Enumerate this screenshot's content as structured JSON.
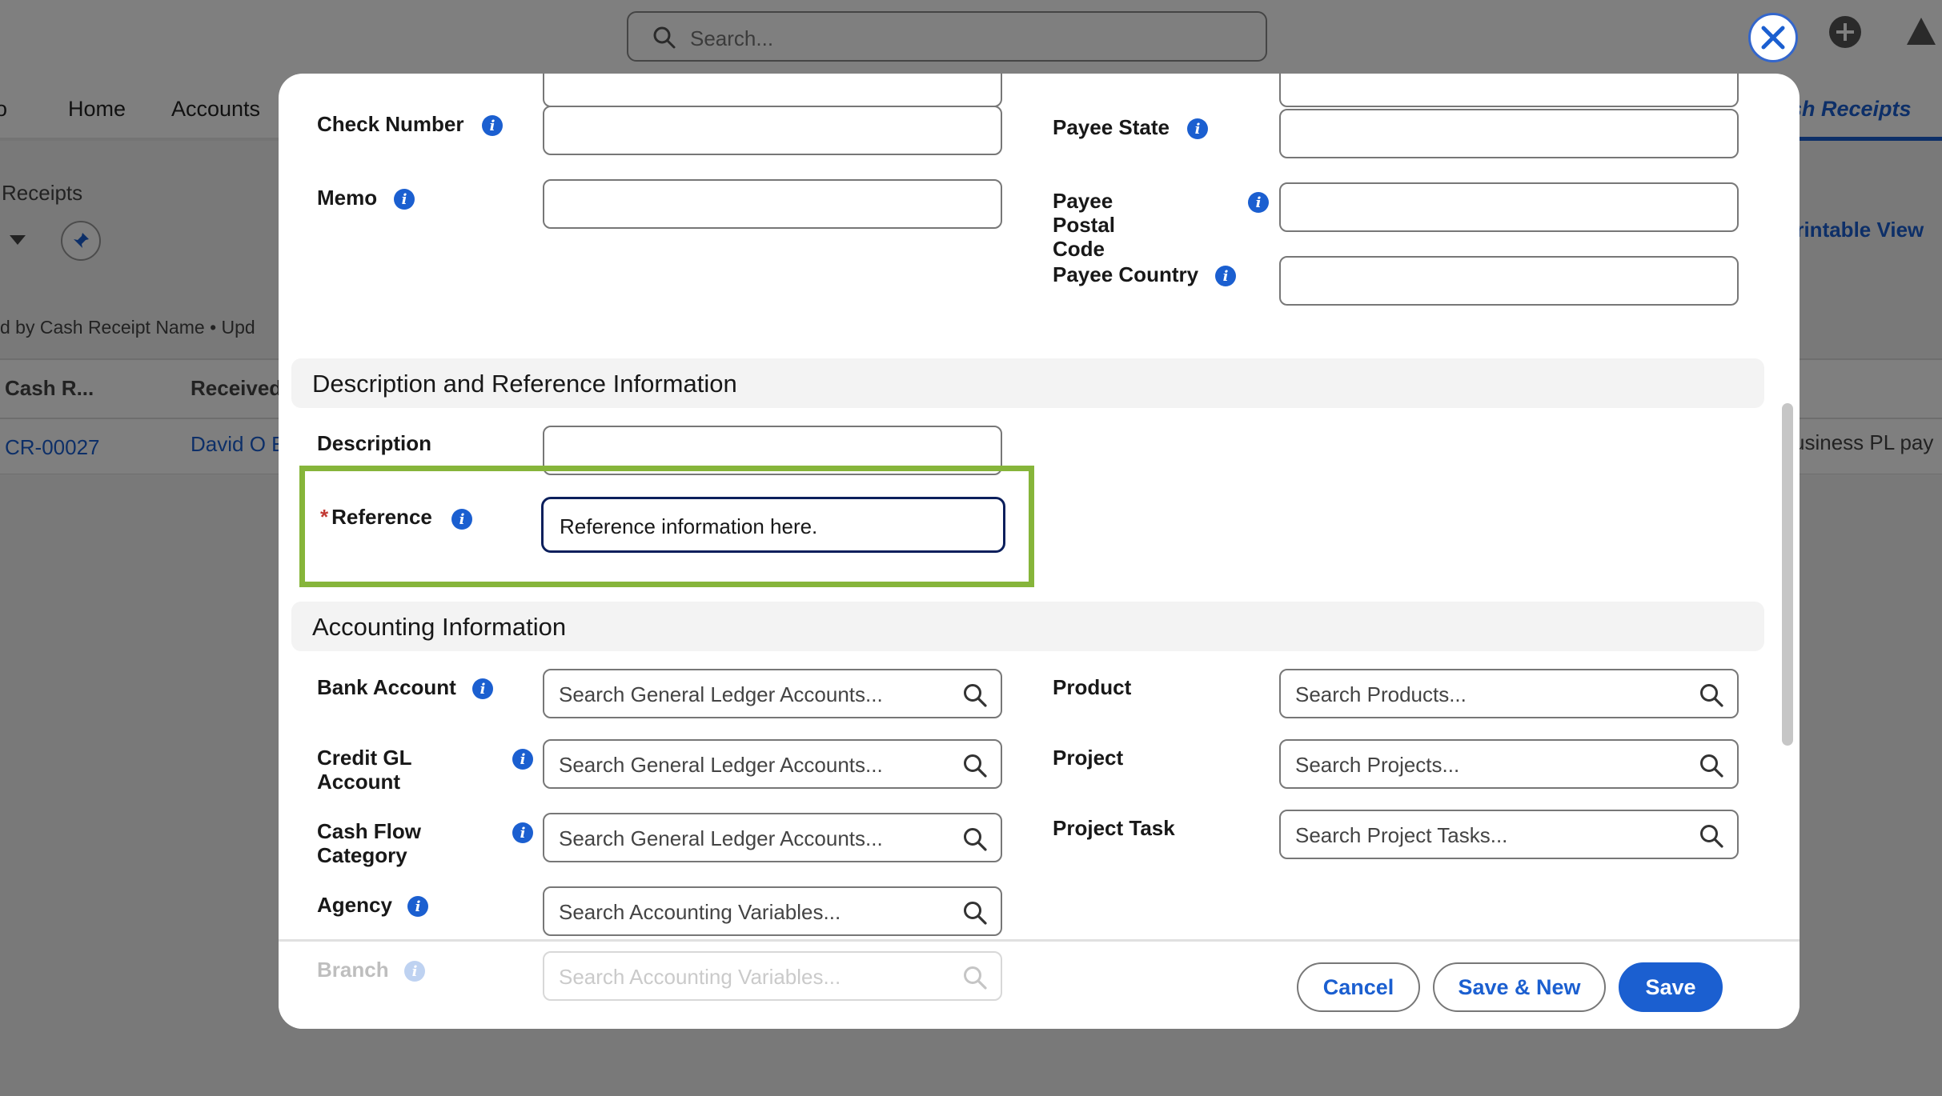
{
  "background": {
    "search_placeholder": "Search...",
    "nav": {
      "item0": "o",
      "home": "Home",
      "accounts": "Accounts",
      "active_tab": "sh Receipts"
    },
    "list_title": "Receipts",
    "printable_view": "Printable View",
    "sorted_by": "d by Cash Receipt Name • Upd",
    "table": {
      "col1": "Cash R...",
      "col2": "Received",
      "row1_id": "CR-00027",
      "row1_received": "David O E",
      "row1_desc": "usiness PL pay"
    }
  },
  "modal": {
    "fields_left": {
      "check_number": "Check Number",
      "memo": "Memo"
    },
    "fields_right": {
      "payee_state": "Payee State",
      "payee_postal_code": "Payee Postal Code",
      "payee_country": "Payee Country"
    },
    "sections": {
      "description": "Description and Reference Information",
      "accounting": "Accounting Information"
    },
    "description_label": "Description",
    "reference": {
      "required_mark": "*",
      "label": "Reference",
      "value": "Reference information here."
    },
    "accounting": {
      "bank_account": {
        "label": "Bank Account",
        "placeholder": "Search General Ledger Accounts..."
      },
      "credit_gl": {
        "label": "Credit GL Account",
        "placeholder": "Search General Ledger Accounts..."
      },
      "cash_flow": {
        "label": "Cash Flow Category",
        "placeholder": "Search General Ledger Accounts..."
      },
      "agency": {
        "label": "Agency",
        "placeholder": "Search Accounting Variables..."
      },
      "branch": {
        "label": "Branch",
        "placeholder": "Search Accounting Variables..."
      },
      "product": {
        "label": "Product",
        "placeholder": "Search Products..."
      },
      "project": {
        "label": "Project",
        "placeholder": "Search Projects..."
      },
      "project_task": {
        "label": "Project Task",
        "placeholder": "Search Project Tasks..."
      }
    },
    "footer": {
      "cancel": "Cancel",
      "save_new": "Save & New",
      "save": "Save"
    }
  },
  "colors": {
    "accent": "#1b5fd0",
    "highlight": "#86b53a",
    "required": "#c23934"
  },
  "icons": [
    "search-icon",
    "close-icon",
    "info-icon",
    "plus-circle-icon",
    "pin-icon",
    "magnifier-icon"
  ]
}
